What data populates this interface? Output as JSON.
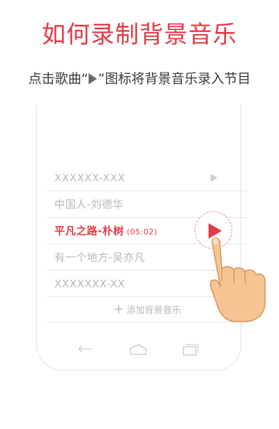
{
  "header": {
    "title": "如何录制背景音乐",
    "instruction_before": "点击歌曲“",
    "instruction_after": "”图标将背景音乐录入节目"
  },
  "songs": [
    {
      "name": "XXXXXX-XXX",
      "duration": "",
      "active": false
    },
    {
      "name": "中国人-刘德华",
      "duration": "",
      "active": false
    },
    {
      "name": "平凡之路-朴树",
      "duration": "(05:02)",
      "active": true
    },
    {
      "name": "有一个地方-吴亦凡",
      "duration": "",
      "active": false
    },
    {
      "name": "XXXXXXX-XX",
      "duration": "",
      "active": false
    }
  ],
  "add_button": {
    "icon": "plus-icon",
    "label": "添加背景音乐"
  },
  "navigation": [
    "back-icon",
    "home-icon",
    "recent-apps-icon"
  ],
  "colors": {
    "accent": "#e23a45",
    "muted": "#b8b8b8",
    "divider": "#e6e6e6",
    "hand": "#f6c493"
  }
}
